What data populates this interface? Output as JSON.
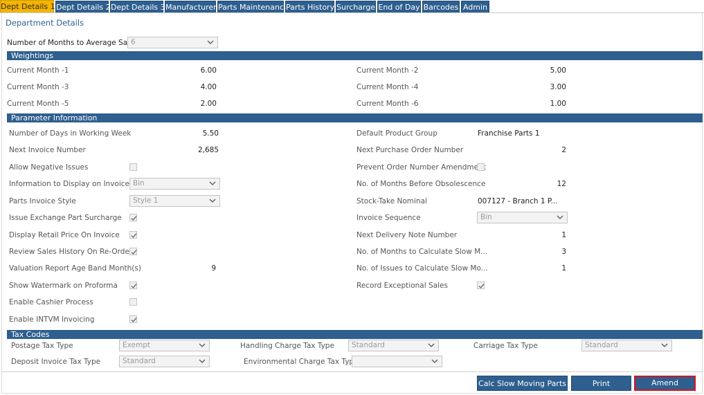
{
  "tabs": [
    {
      "label": "Dept Details 1",
      "active": true
    },
    {
      "label": "Dept Details 2"
    },
    {
      "label": "Dept Details 3"
    },
    {
      "label": "Manufacturer"
    },
    {
      "label": "Parts Maintenance"
    },
    {
      "label": "Parts History"
    },
    {
      "label": "Surcharge"
    },
    {
      "label": "End of Day"
    },
    {
      "label": "Barcodes"
    },
    {
      "label": "Admin"
    }
  ],
  "page_title": "Department Details",
  "avg_months": {
    "label": "Number of Months to Average Sal...",
    "value": "6"
  },
  "weightings": {
    "title": "Weightings",
    "items": [
      {
        "label": "Current Month -1",
        "value": "6.00"
      },
      {
        "label": "Current Month -2",
        "value": "5.00"
      },
      {
        "label": "Current Month -3",
        "value": "4.00"
      },
      {
        "label": "Current Month -4",
        "value": "3.00"
      },
      {
        "label": "Current Month -5",
        "value": "2.00"
      },
      {
        "label": "Current Month -6",
        "value": "1.00"
      }
    ]
  },
  "params": {
    "title": "Parameter Information",
    "days_working_week": {
      "label": "Number of Days in Working Week",
      "value": "5.50"
    },
    "next_invoice": {
      "label": "Next Invoice Number",
      "value": "2,685"
    },
    "allow_negative": {
      "label": "Allow Negative Issues",
      "checked": false
    },
    "info_invoice": {
      "label": "Information to Display on Invoice",
      "value": "Bin"
    },
    "invoice_style": {
      "label": "Parts Invoice Style",
      "value": "Style 1"
    },
    "exchange_surcharge": {
      "label": "Issue Exchange Part Surcharge",
      "checked": true
    },
    "retail_price": {
      "label": "Display Retail Price On Invoice",
      "checked": true
    },
    "review_sales": {
      "label": "Review Sales History On Re-Order",
      "checked": true
    },
    "valuation_age": {
      "label": "Valuation Report Age Band Month(s)",
      "value": "9"
    },
    "watermark": {
      "label": "Show Watermark on Proforma",
      "checked": true
    },
    "cashier": {
      "label": "Enable Cashier Process",
      "checked": false
    },
    "intvm": {
      "label": "Enable INTVM Invoicing",
      "checked": true
    },
    "default_group": {
      "label": "Default Product Group",
      "value": "Franchise Parts 1"
    },
    "next_po": {
      "label": "Next Purchase Order Number",
      "value": "2"
    },
    "prevent_order": {
      "label": "Prevent Order Number Amendment",
      "checked": false
    },
    "obsolescence": {
      "label": "No. of Months Before Obsolescence",
      "value": "12"
    },
    "stocktake": {
      "label": "Stock-Take Nominal",
      "value": "007127 - Branch 1 P..."
    },
    "invoice_seq": {
      "label": "Invoice Sequence",
      "value": "Bin"
    },
    "next_delivery": {
      "label": "Next Delivery Note Number",
      "value": "1"
    },
    "slow_months": {
      "label": "No. of Months to Calculate Slow M...",
      "value": "3"
    },
    "slow_issues": {
      "label": "No. of Issues to Calculate Slow Mo...",
      "value": "1"
    },
    "exceptional": {
      "label": "Record Exceptional Sales",
      "checked": true
    }
  },
  "tax": {
    "title": "Tax Codes",
    "postage": {
      "label": "Postage Tax Type",
      "value": "Exempt"
    },
    "handling": {
      "label": "Handling Charge Tax Type",
      "value": "Standard"
    },
    "carriage": {
      "label": "Carriage Tax Type",
      "value": "Standard"
    },
    "deposit": {
      "label": "Deposit Invoice Tax Type",
      "value": "Standard"
    },
    "environmental": {
      "label": "Environmental Charge Tax Type",
      "value": ""
    }
  },
  "buttons": {
    "calc": "Calc Slow Moving Parts",
    "print": "Print",
    "amend": "Amend"
  },
  "colors": {
    "tab_bg": "#2e5f8f",
    "tab_active": "#f4b400",
    "section_bg": "#2e5f8f",
    "amend_border": "#d8141c"
  }
}
